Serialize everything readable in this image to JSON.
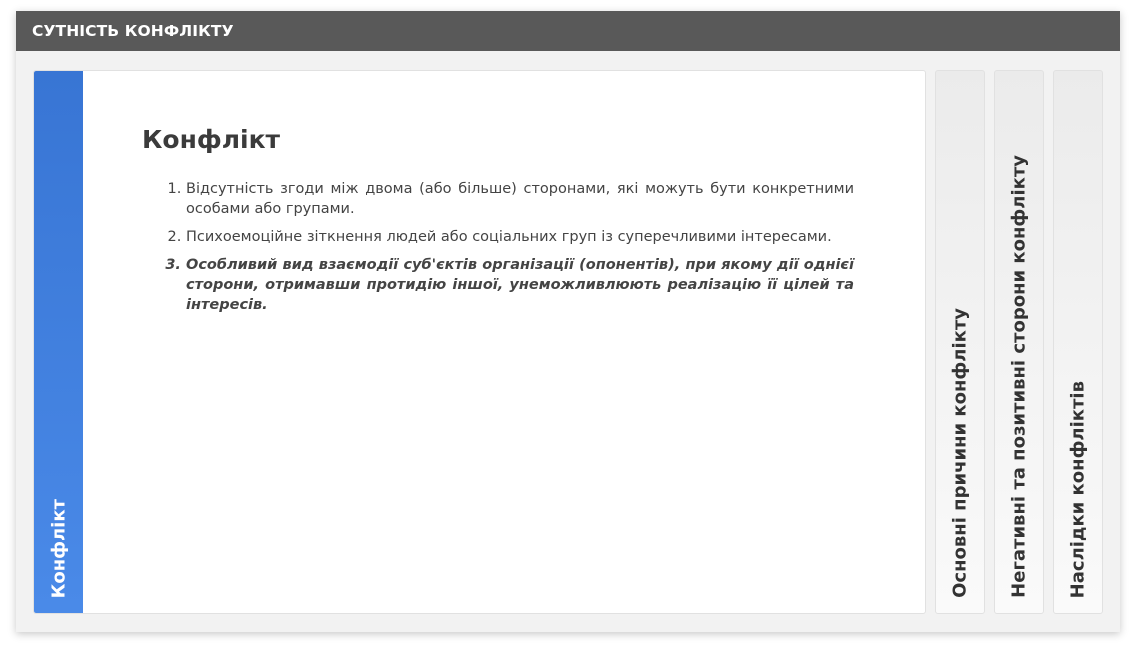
{
  "title_bar": {
    "title": "СУТНІСТЬ КОНФЛІКТУ"
  },
  "accordion": {
    "active_tab": {
      "label": "Конфлікт"
    },
    "content": {
      "heading": "Конфлікт",
      "items": [
        "Відсутність згоди між двома (або більше) сторонами, які можуть бути конкретними особами або групами.",
        "Психоемоційне зіткнення людей або соціальних груп із суперечливими інтересами.",
        "Особливий вид взаємодії суб'єктів організації (опонентів), при якому дії однієї сторони, отримавши протидію іншої, унеможливлюють реалізацію її цілей та інтересів."
      ]
    },
    "tabs": [
      {
        "label": "Основні причини конфлікту"
      },
      {
        "label": "Негативні та позитивні сторони конфлікту"
      },
      {
        "label": "Наслідки конфліктів"
      }
    ]
  },
  "colors": {
    "title_bar_bg": "#595959",
    "active_tab_bg": "#3875d4",
    "frame_bg": "#f2f2f2",
    "text": "#444444"
  }
}
